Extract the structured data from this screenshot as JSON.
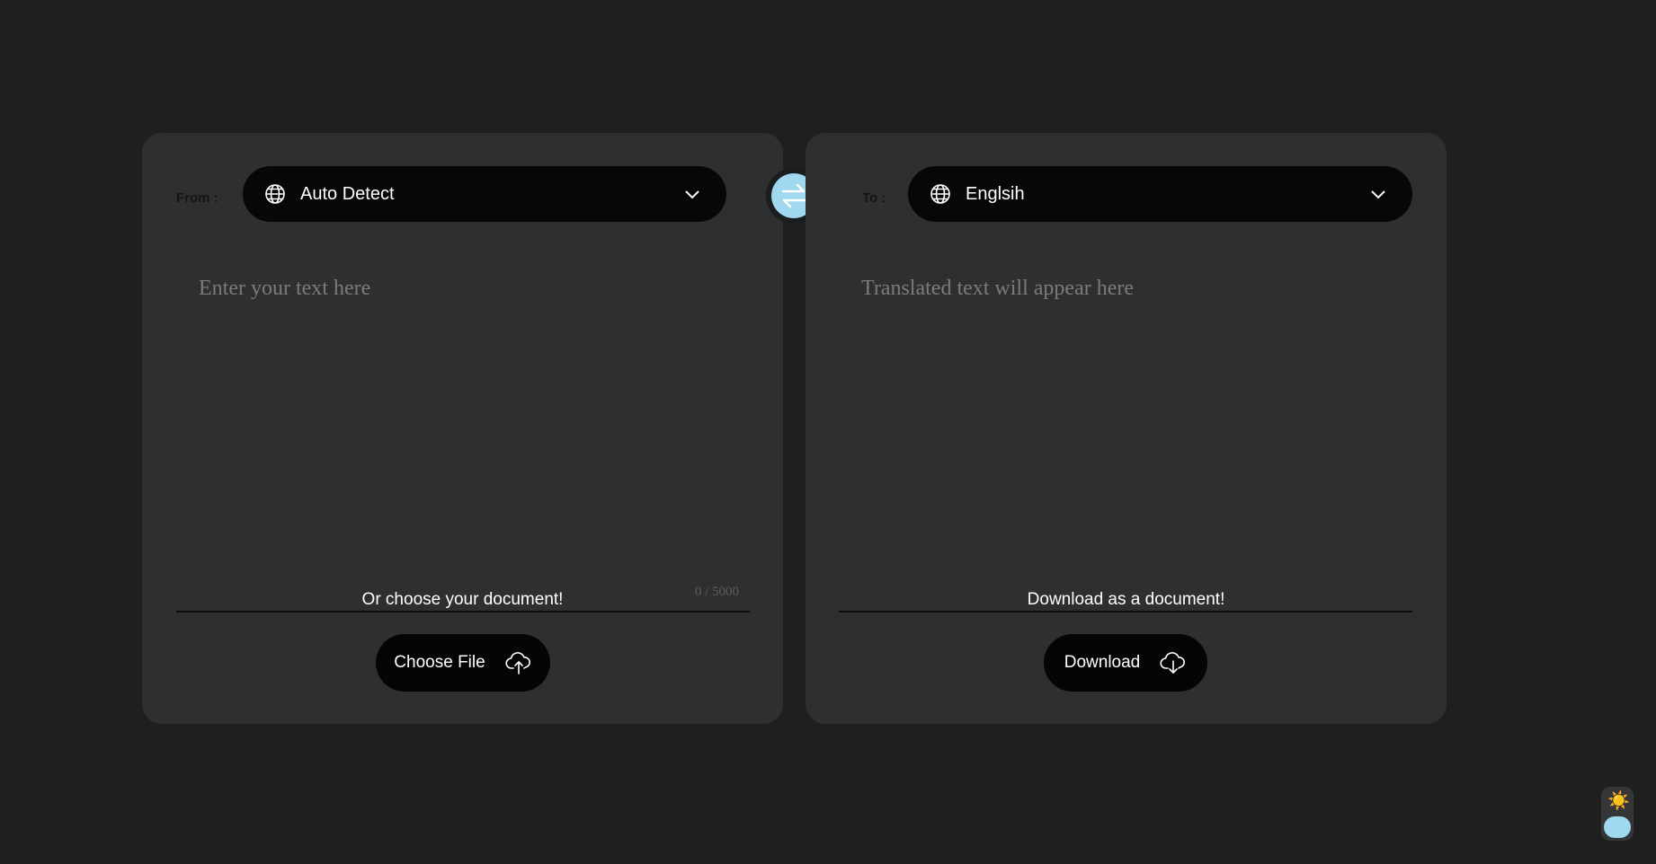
{
  "source": {
    "label": "From :",
    "language": "Auto Detect",
    "placeholder": "Enter your text here",
    "counter": "0 / 5000",
    "document_prompt": "Or choose your document!",
    "button_label": "Choose File",
    "button_icon": "cloud-upload-icon"
  },
  "target": {
    "label": "To :",
    "language": "Englsih",
    "placeholder": "Translated text will appear here",
    "document_prompt": "Download as a document!",
    "button_label": "Download",
    "button_icon": "cloud-download-icon"
  },
  "swap": {
    "icon": "swap-arrows-icon",
    "color": "#9fd8ef"
  },
  "theme_toggle": {
    "icon": "sun-icon",
    "sun_glyph": "☀️",
    "knob_color": "#9fd8ef"
  },
  "colors": {
    "background": "#1f1f20",
    "card": "#2e2f31",
    "pill": "#070707",
    "accent": "#9fd8ef"
  }
}
